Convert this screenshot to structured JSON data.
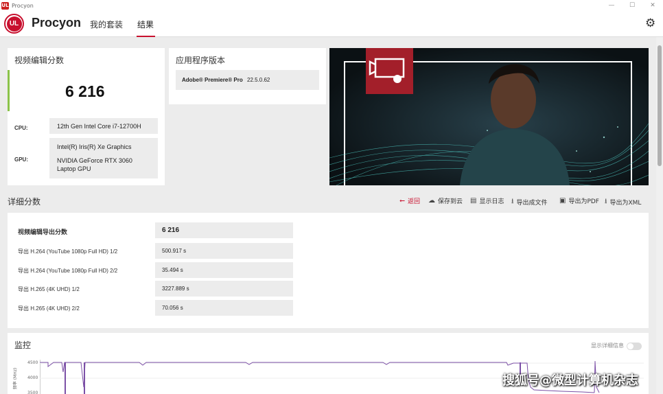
{
  "window": {
    "title": "Procyon",
    "app_icon": "UL"
  },
  "header": {
    "logo_text": "UL",
    "brand": "Procyon",
    "tabs": [
      {
        "label": "我的套装",
        "active": false
      },
      {
        "label": "结果",
        "active": true
      }
    ],
    "settings_icon": "gear-icon"
  },
  "score_card": {
    "title": "视频编辑分数",
    "score": "6 216",
    "cpu_label": "CPU:",
    "cpu_value": "12th Gen Intel Core i7-12700H",
    "gpu_label": "GPU:",
    "gpu_value_1": "Intel(R) Iris(R) Xe Graphics",
    "gpu_value_2": "NVIDIA GeForce RTX 3060 Laptop GPU"
  },
  "app_version": {
    "title": "应用程序版本",
    "app_name": "Adobe® Premiere® Pro",
    "version": "22.5.0.62"
  },
  "details": {
    "title": "详细分数",
    "actions": [
      {
        "label": "返回",
        "icon": "back-arrow-icon"
      },
      {
        "label": "保存到云",
        "icon": "cloud-upload-icon"
      },
      {
        "label": "显示日志",
        "icon": "document-icon"
      },
      {
        "label": "导出成文件",
        "icon": "download-icon"
      },
      {
        "label": "导出为PDF",
        "icon": "save-icon"
      },
      {
        "label": "导出为XML",
        "icon": "download-icon"
      }
    ],
    "rows": [
      {
        "label": "视频编辑导出分数",
        "value": "6 216"
      },
      {
        "label": "导出 H.264 (YouTube 1080p Full HD) 1/2",
        "value": "500.917 s"
      },
      {
        "label": "导出 H.264 (YouTube 1080p Full HD) 2/2",
        "value": "35.494 s"
      },
      {
        "label": "导出 H.265 (4K UHD) 1/2",
        "value": "3227.889 s"
      },
      {
        "label": "导出 H.265 (4K UHD) 2/2",
        "value": "70.056 s"
      }
    ]
  },
  "monitor": {
    "title": "监控",
    "toggle_label": "显示详细信息",
    "toggle_on": false,
    "y_axis_label": "频率 (MHz)",
    "tick_labels": [
      "4500",
      "4000",
      "3500"
    ],
    "line_color": "#7b4fa6"
  },
  "colors": {
    "accent": "#c8102e",
    "score_bar": "#8bc34a"
  },
  "watermark": "搜狐号@微型计算机杂志"
}
